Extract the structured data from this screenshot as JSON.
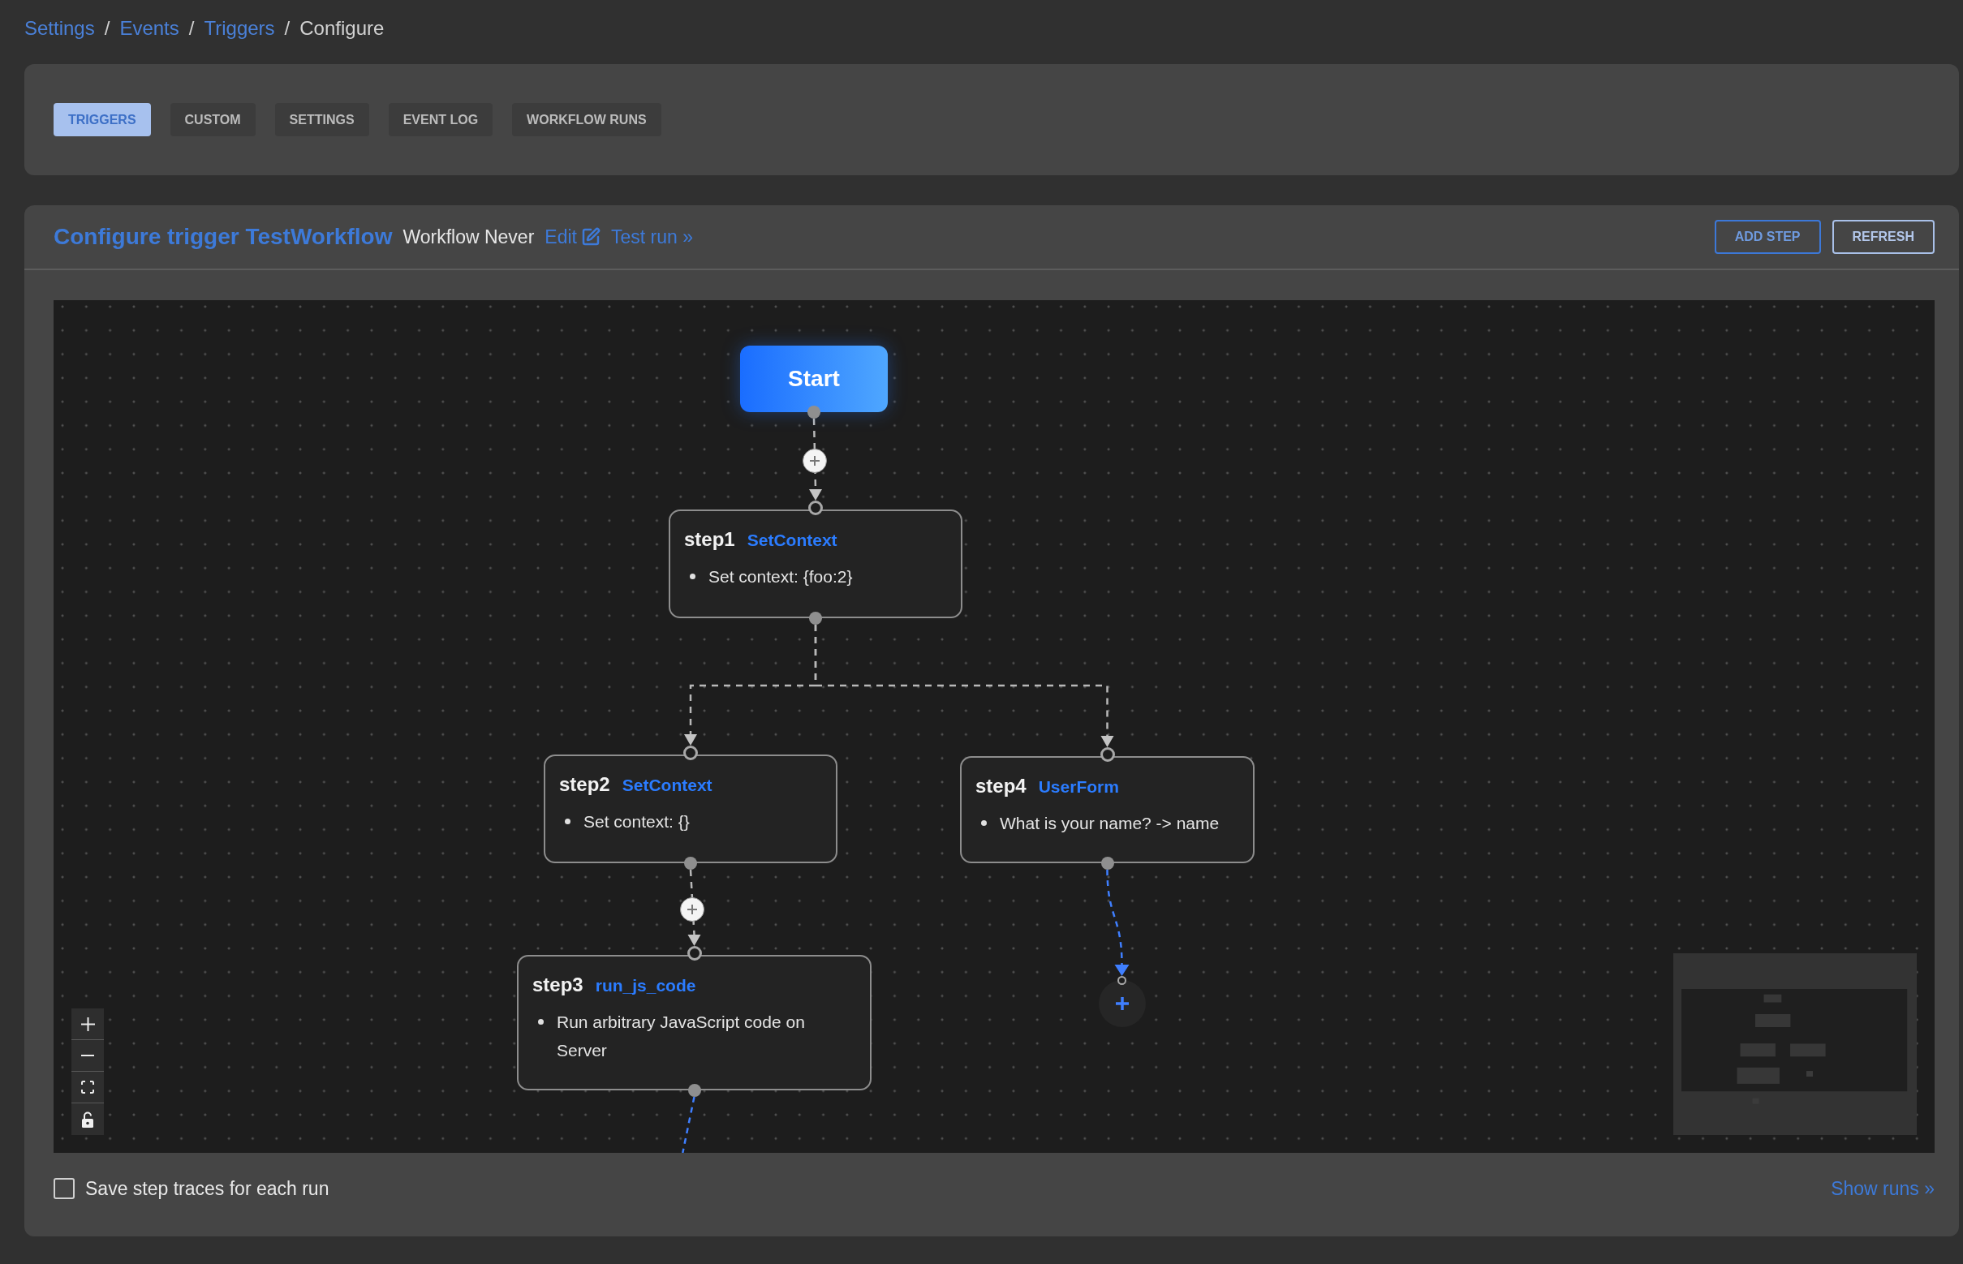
{
  "breadcrumb": [
    {
      "label": "Settings",
      "current": false,
      "separator": "/"
    },
    {
      "label": "Events",
      "current": false,
      "separator": "/"
    },
    {
      "label": "Triggers",
      "current": false,
      "separator": "/"
    },
    {
      "label": "Configure",
      "current": true
    }
  ],
  "tabs": [
    {
      "label": "TRIGGERS",
      "selected": true
    },
    {
      "label": "CUSTOM",
      "selected": false
    },
    {
      "label": "SETTINGS",
      "selected": false
    },
    {
      "label": "EVENT LOG",
      "selected": false
    },
    {
      "label": "WORKFLOW RUNS",
      "selected": false
    }
  ],
  "header": {
    "title": "Configure trigger TestWorkflow",
    "status": "Workflow Never",
    "edit_link": "Edit",
    "test_link": "Test run »",
    "buttons": [
      {
        "label": "ADD STEP",
        "kind": "primary"
      },
      {
        "label": "REFRESH",
        "kind": "secondary"
      }
    ]
  },
  "flow": {
    "start": "Start",
    "steps": [
      {
        "name": "step1",
        "type": "SetContext",
        "details": [
          "Set context: {foo:2}"
        ],
        "children": [
          {
            "name": "step2",
            "type": "SetContext",
            "details": [
              "Set context: {}"
            ],
            "children": [
              {
                "name": "step3",
                "type": "run_js_code",
                "details": [
                  "Run arbitrary JavaScript code on Server"
                ]
              }
            ]
          },
          {
            "name": "step4",
            "type": "UserForm",
            "details": [
              "What is your name? -> name"
            ]
          }
        ]
      }
    ]
  },
  "footer": {
    "checkbox": {
      "label": "Save step traces for each run",
      "checked": false
    },
    "link": "Show runs »"
  }
}
